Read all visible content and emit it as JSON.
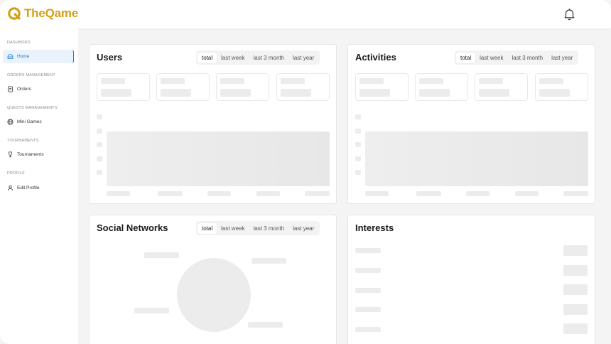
{
  "app": {
    "name": "TheQame",
    "brand_color": "#d4a017",
    "accent_color": "#1b78d0"
  },
  "topbar": {
    "bell_icon": "bell-icon"
  },
  "sidebar": {
    "sections": [
      {
        "title": "DASHBORD",
        "items": [
          {
            "label": "Home",
            "icon": "home-icon",
            "active": true
          }
        ]
      },
      {
        "title": "ORDERS MANAGEMENT",
        "items": [
          {
            "label": "Orders",
            "icon": "orders-icon",
            "active": false
          }
        ]
      },
      {
        "title": "QUESTS MANAGEMENTS",
        "items": [
          {
            "label": "Mini Games",
            "icon": "globe-icon",
            "active": false
          }
        ]
      },
      {
        "title": "TOURNAMENTS",
        "items": [
          {
            "label": "Tournaments",
            "icon": "trophy-icon",
            "active": false
          }
        ]
      },
      {
        "title": "PROFILE",
        "items": [
          {
            "label": "Edit Profile",
            "icon": "user-edit-icon",
            "active": false
          }
        ]
      }
    ]
  },
  "cards": {
    "users": {
      "title": "Users",
      "tabs": [
        "total",
        "last week",
        "last 3 month",
        "last year"
      ],
      "active_tab": "total"
    },
    "activities": {
      "title": "Activities",
      "tabs": [
        "total",
        "last week",
        "last 3 month",
        "last year"
      ],
      "active_tab": "total"
    },
    "social": {
      "title": "Social Networks",
      "tabs": [
        "total",
        "last week",
        "last 3 month",
        "last year"
      ],
      "active_tab": "total"
    },
    "interests": {
      "title": "Interests"
    }
  }
}
